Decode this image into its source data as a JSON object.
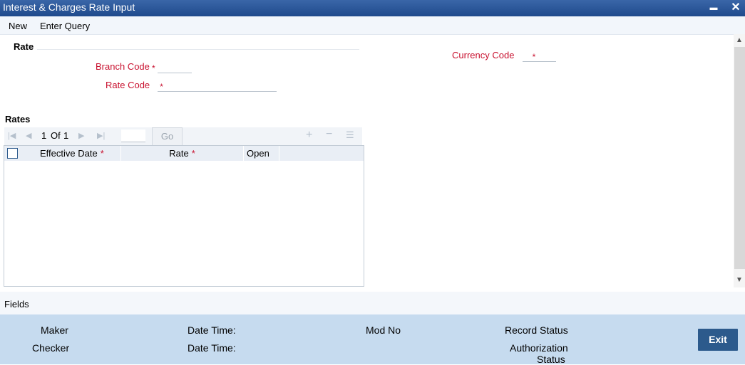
{
  "window": {
    "title": "Interest & Charges Rate Input",
    "minimize": "▬",
    "close": "✕"
  },
  "menu": {
    "new": "New",
    "enter_query": "Enter Query"
  },
  "rate_section": {
    "title": "Rate"
  },
  "form": {
    "branch_code": {
      "label": "Branch Code",
      "value": ""
    },
    "rate_code": {
      "label": "Rate Code",
      "value": ""
    },
    "currency_code": {
      "label": "Currency Code",
      "value": ""
    },
    "required_mark": "*"
  },
  "rates": {
    "title": "Rates",
    "page_current": "1",
    "page_of": "Of",
    "page_total": "1",
    "go_label": "Go",
    "columns": [
      "Effective Date",
      "Rate",
      "Open"
    ],
    "required_mark": "*"
  },
  "fields_bar": {
    "label": "Fields"
  },
  "audit": {
    "maker": "Maker",
    "checker": "Checker",
    "maker_date_time": "Date Time:",
    "checker_date_time": "Date Time:",
    "mod_no": "Mod No",
    "record_status": "Record Status",
    "authorization_status_line1": "Authorization",
    "authorization_status_line2": "Status"
  },
  "exit_label": "Exit",
  "colors": {
    "titlebar": "#1f4a8c",
    "required": "#c8102e",
    "footer": "#c6dbef",
    "exit_button": "#2c5a8c"
  }
}
